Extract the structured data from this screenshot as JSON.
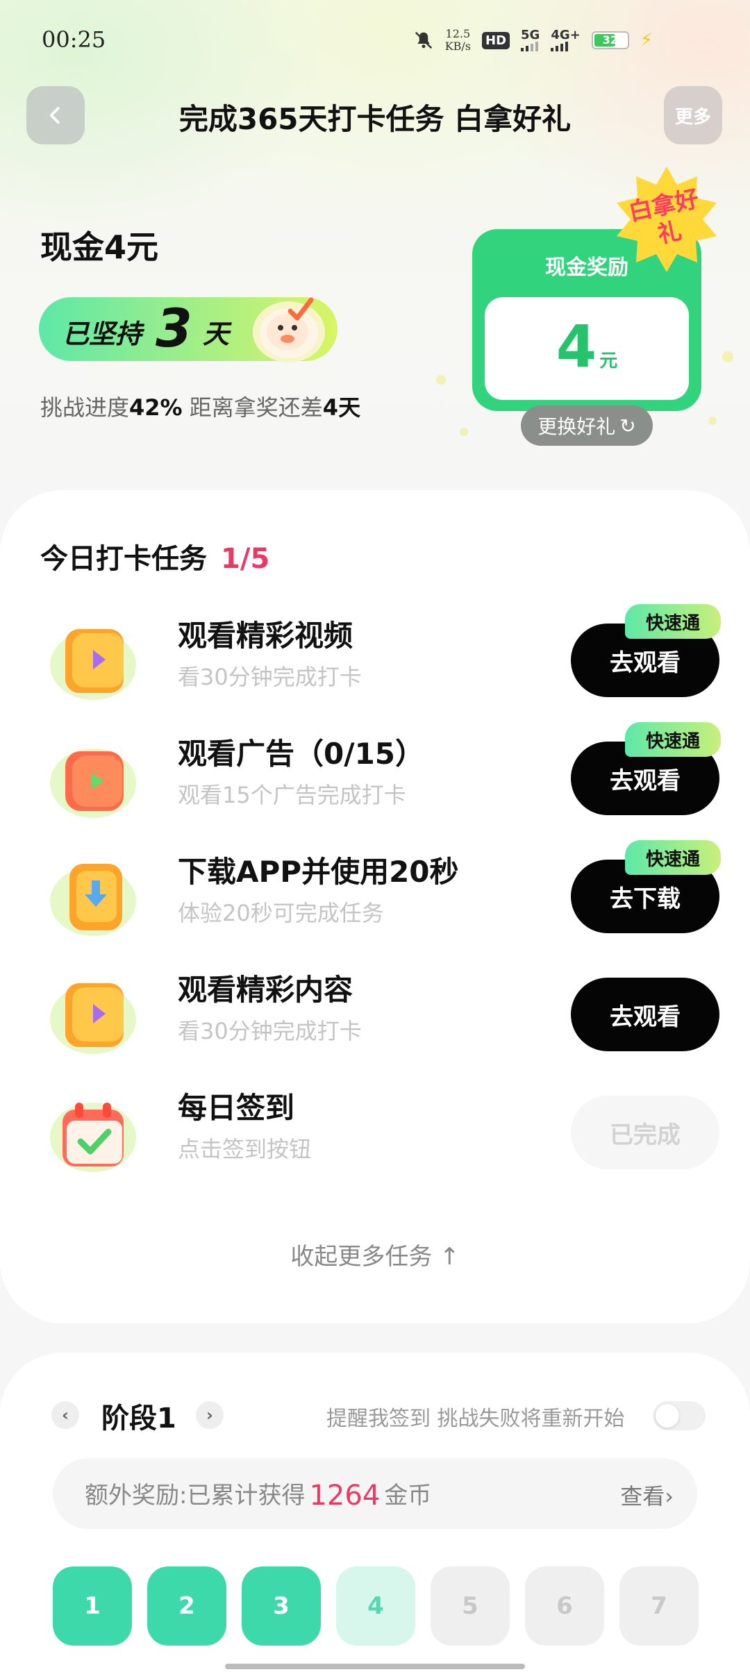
{
  "status_bar": {
    "time": "00:25",
    "speed_value": "12.5",
    "speed_unit": "KB/s",
    "hd": "HD",
    "net1": "5G",
    "net2": "4G+",
    "battery": "32"
  },
  "header": {
    "title": "完成365天打卡任务 白拿好礼",
    "more_label": "更多"
  },
  "hero": {
    "cash_title": "现金4元",
    "persist_prefix": "已坚持",
    "persist_days": "3",
    "persist_suffix": "天",
    "progress_prefix": "挑战进度",
    "progress_percent": "42%",
    "progress_mid": " 距离拿奖还差",
    "remaining_days": "4天",
    "reward_label": "现金奖励",
    "reward_amount": "4",
    "reward_unit": "元",
    "badge_text": "白拿好礼",
    "swap_label": "更换好礼",
    "swap_icon": "↻"
  },
  "tasks": {
    "title": "今日打卡任务",
    "count": "1/5",
    "fast_tag": "快速通",
    "items": [
      {
        "name": "观看精彩视频",
        "desc": "看30分钟完成打卡",
        "button": "去观看"
      },
      {
        "name": "观看广告（0/15）",
        "desc": "观看15个广告完成打卡",
        "button": "去观看"
      },
      {
        "name": "下载APP并使用20秒",
        "desc": "体验20秒可完成任务",
        "button": "去下载"
      },
      {
        "name": "观看精彩内容",
        "desc": "看30分钟完成打卡",
        "button": "去观看"
      },
      {
        "name": "每日签到",
        "desc": "点击签到按钮",
        "button": "已完成"
      }
    ],
    "collapse_label": "收起更多任务 ↑"
  },
  "stage": {
    "label": "阶段1",
    "remind_text": "提醒我签到 挑战失败将重新开始",
    "bonus_prefix": "额外奖励:已累计获得",
    "bonus_amount": "1264",
    "bonus_unit": "金币",
    "view_label": "查看›",
    "days": [
      "1",
      "2",
      "3",
      "4",
      "5",
      "6",
      "7"
    ]
  },
  "colors": {
    "accent_green": "#31d37c",
    "highlight_pink": "#e83a64",
    "day_done": "#3ed9ab"
  }
}
